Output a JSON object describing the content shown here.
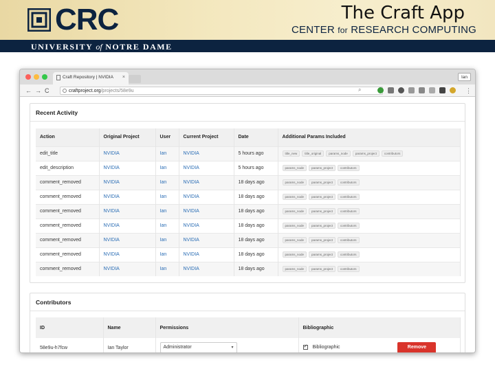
{
  "slide": {
    "title": "The Craft App",
    "logo_text": "CRC",
    "center_text_prefix": "CENTER",
    "center_text_for": "for",
    "center_text_suffix": "RESEARCH COMPUTING",
    "university_pre": "UNIVERSITY",
    "university_of": "of",
    "university_post": "NOTRE DAME",
    "colors": {
      "navy": "#0c2340",
      "gold": "#e9d8a3"
    }
  },
  "browser": {
    "tab_title": "Craft Repository | NVIDIA",
    "tab_close": "×",
    "user": "Ian",
    "url_host": "craftproject.org",
    "url_path": "/projects/58e9u",
    "nav": {
      "back": "←",
      "forward": "→",
      "reload": "C"
    }
  },
  "recent_activity": {
    "title": "Recent Activity",
    "columns": [
      "Action",
      "Original Project",
      "User",
      "Current Project",
      "Date",
      "Additional Params Included"
    ],
    "rows": [
      {
        "action": "edit_title",
        "original": "NVIDIA",
        "user": "Ian",
        "current": "NVIDIA",
        "date": "5 hours ago",
        "params": [
          "title_new",
          "title_original",
          "params_node",
          "params_project",
          "contributors"
        ]
      },
      {
        "action": "edit_description",
        "original": "NVIDIA",
        "user": "Ian",
        "current": "NVIDIA",
        "date": "5 hours ago",
        "params": [
          "params_node",
          "params_project",
          "contributors"
        ]
      },
      {
        "action": "comment_removed",
        "original": "NVIDIA",
        "user": "Ian",
        "current": "NVIDIA",
        "date": "18 days ago",
        "params": [
          "params_node",
          "params_project",
          "contributors"
        ]
      },
      {
        "action": "comment_removed",
        "original": "NVIDIA",
        "user": "Ian",
        "current": "NVIDIA",
        "date": "18 days ago",
        "params": [
          "params_node",
          "params_project",
          "contributors"
        ]
      },
      {
        "action": "comment_removed",
        "original": "NVIDIA",
        "user": "Ian",
        "current": "NVIDIA",
        "date": "18 days ago",
        "params": [
          "params_node",
          "params_project",
          "contributors"
        ]
      },
      {
        "action": "comment_removed",
        "original": "NVIDIA",
        "user": "Ian",
        "current": "NVIDIA",
        "date": "18 days ago",
        "params": [
          "params_node",
          "params_project",
          "contributors"
        ]
      },
      {
        "action": "comment_removed",
        "original": "NVIDIA",
        "user": "Ian",
        "current": "NVIDIA",
        "date": "18 days ago",
        "params": [
          "params_node",
          "params_project",
          "contributors"
        ]
      },
      {
        "action": "comment_removed",
        "original": "NVIDIA",
        "user": "Ian",
        "current": "NVIDIA",
        "date": "18 days ago",
        "params": [
          "params_node",
          "params_project",
          "contributors"
        ]
      },
      {
        "action": "comment_removed",
        "original": "NVIDIA",
        "user": "Ian",
        "current": "NVIDIA",
        "date": "18 days ago",
        "params": [
          "params_node",
          "params_project",
          "contributors"
        ]
      }
    ]
  },
  "contributors": {
    "title": "Contributors",
    "columns": [
      "ID",
      "Name",
      "Permissions",
      "Bibliographic"
    ],
    "rows": [
      {
        "id": "58e9u-h7fcw",
        "name": "Ian Taylor",
        "permission": "Administrator",
        "bibliographic": "Bibliographic",
        "remove_label": "Remove"
      }
    ]
  }
}
